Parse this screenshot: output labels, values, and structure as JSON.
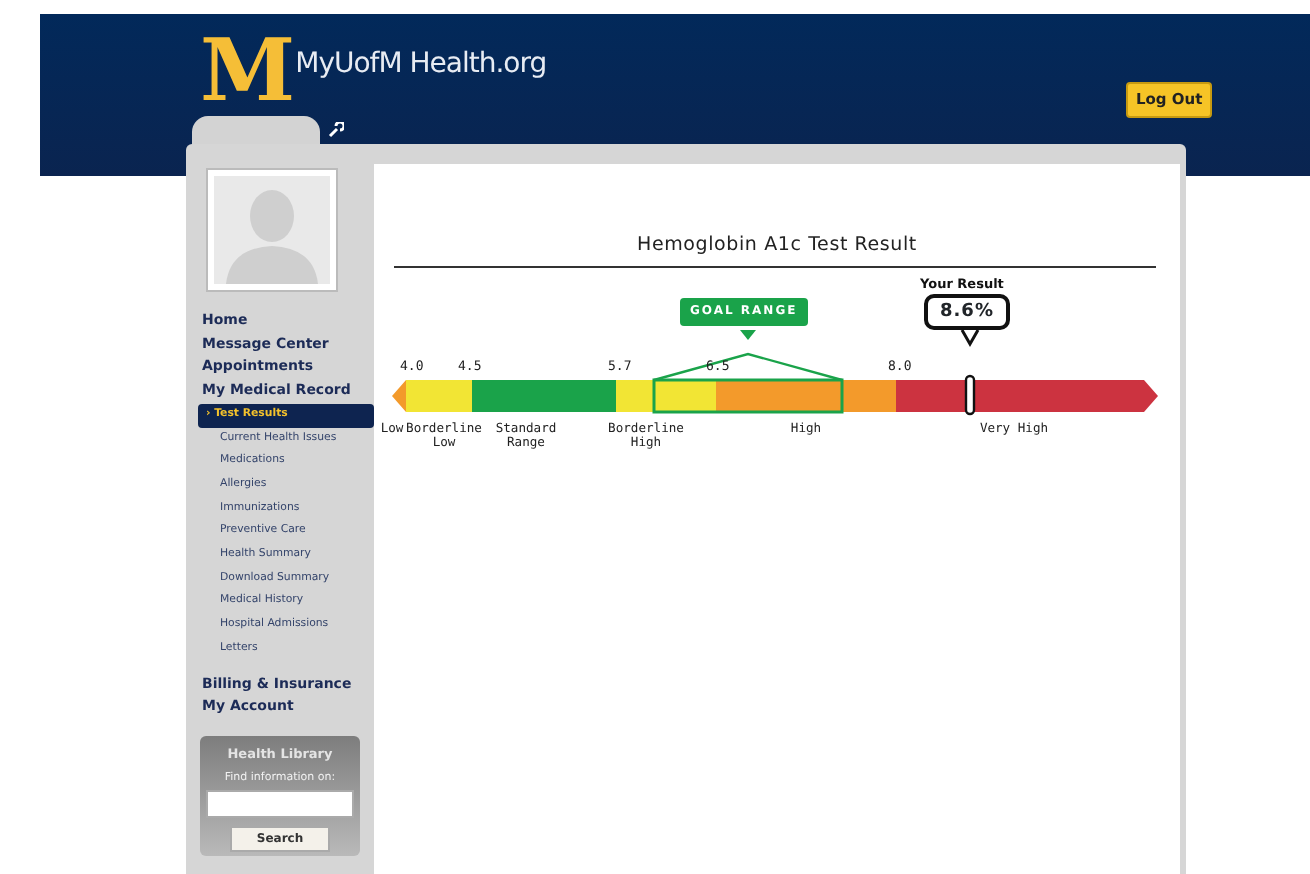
{
  "header": {
    "logo_mark": "M",
    "logo_text": "MyUofM Health.org",
    "logout": "Log Out"
  },
  "sidebar": {
    "items": [
      {
        "label": "Home",
        "kind": "main",
        "selected": false
      },
      {
        "label": "Message Center",
        "kind": "main",
        "selected": false
      },
      {
        "label": "Appointments",
        "kind": "main",
        "selected": false
      },
      {
        "label": "My Medical Record",
        "kind": "main",
        "selected": false
      },
      {
        "label": "› Test Results",
        "kind": "sub",
        "selected": true
      },
      {
        "label": "Current Health Issues",
        "kind": "sub",
        "selected": false
      },
      {
        "label": "Medications",
        "kind": "sub",
        "selected": false
      },
      {
        "label": "Allergies",
        "kind": "sub",
        "selected": false
      },
      {
        "label": "Immunizations",
        "kind": "sub",
        "selected": false
      },
      {
        "label": "Preventive Care",
        "kind": "sub",
        "selected": false
      },
      {
        "label": "Health Summary",
        "kind": "sub",
        "selected": false
      },
      {
        "label": "Download Summary",
        "kind": "sub",
        "selected": false
      },
      {
        "label": "Medical History",
        "kind": "sub",
        "selected": false
      },
      {
        "label": "Hospital Admissions",
        "kind": "sub",
        "selected": false
      },
      {
        "label": "Letters",
        "kind": "sub",
        "selected": false
      },
      {
        "label": "Billing & Insurance",
        "kind": "main",
        "selected": false
      },
      {
        "label": "My Account",
        "kind": "main",
        "selected": false
      }
    ],
    "health_library": {
      "title": "Health Library",
      "label": "Find information on:",
      "button": "Search"
    }
  },
  "content": {
    "title": "Hemoglobin A1c Test Result",
    "scale": {
      "segments": [
        {
          "kind": "arrow-left",
          "color": "#f39a2b"
        },
        {
          "kind": "band",
          "color": "#f2e534"
        },
        {
          "kind": "band",
          "color": "#1aa34a"
        },
        {
          "kind": "band",
          "color": "#f2e534"
        },
        {
          "kind": "band",
          "color": "#f39a2b"
        },
        {
          "kind": "band",
          "color": "#cc3340"
        },
        {
          "kind": "arrow-right",
          "color": "#cc3340"
        }
      ],
      "ticks": [
        "4.0",
        "4.5",
        "5.7",
        "6.5",
        "8.0"
      ],
      "ranges": [
        "Low",
        "Borderline Low",
        "Standard Range",
        "Borderline High",
        "High",
        "Very High"
      ],
      "goal_label": "GOAL RANGE",
      "result_label": "Your Result",
      "result_value": "8.6%"
    }
  }
}
